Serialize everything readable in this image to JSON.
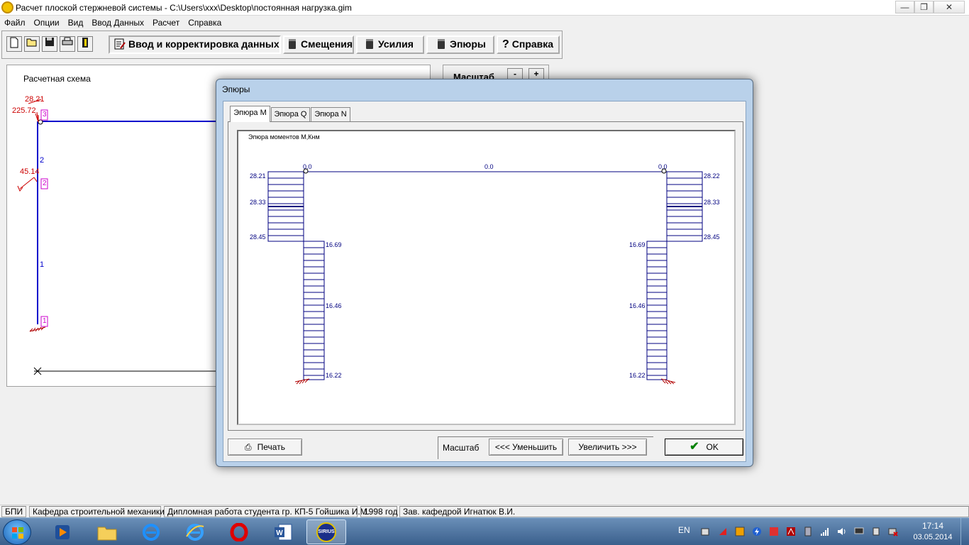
{
  "window": {
    "title": "Расчет плоской стержневой системы - C:\\Users\\xxx\\Desktop\\постоянная нагрузка.gim"
  },
  "menu": [
    "Файл",
    "Опции",
    "Вид",
    "Ввод Данных",
    "Расчет",
    "Справка"
  ],
  "toolbar": {
    "input_label": "Ввод и корректировка данных",
    "disp_label": "Смещения",
    "forces_label": "Усилия",
    "diagrams_label": "Эпюры",
    "help_label": "Справка"
  },
  "scheme": {
    "title": "Расчетная схема",
    "labels": {
      "top_force": "28.21",
      "top_moment": "225.72",
      "mid_force": "45.14",
      "node_3": "3",
      "node_2": "2",
      "node_1": "1",
      "bar_2": "2",
      "bar_1": "1"
    }
  },
  "right_panel": {
    "scale_label": "Масштаб",
    "minus": "-",
    "plus": "+"
  },
  "dialog": {
    "title": "Эпюры",
    "tabs": [
      "Эпюра M",
      "Эпюра Q",
      "Эпюра N"
    ],
    "diagram_title": "Эпюра моментов M,Кнм",
    "labels": {
      "top_left": "0.0",
      "top_mid": "0.0",
      "top_right": "0.0",
      "l_c1": "28.21",
      "l_c2": "28.33",
      "l_c3": "28.45",
      "l_r1": "16.69",
      "l_r2": "16.46",
      "l_r3": "16.22",
      "r_c1": "28.22",
      "r_c2": "28.33",
      "r_c3": "28.45",
      "r_r1": "16.69",
      "r_r2": "16.46",
      "r_r3": "16.22"
    },
    "print_label": "Печать",
    "scale_label": "Масштаб",
    "zoom_out_label": "<<<  Уменьшить",
    "zoom_in_label": "Увеличить  >>>",
    "ok_label": "OK"
  },
  "status": [
    "БПИ",
    "Кафедра строительной механики",
    "Дипломная работа студента гр. КП-5 Гойшика И.М.",
    "1998 год",
    "Зав. кафедрой Игнатюк В.И."
  ],
  "taskbar": {
    "lang": "EN",
    "time": "17:14",
    "date": "03.05.2014",
    "sirius": "SIRIUS"
  },
  "colors": {
    "scheme_line": "#0000cc",
    "load": "#cc0000",
    "node": "#cc00cc",
    "diagram": "#000080",
    "hatch": "#b00000"
  }
}
